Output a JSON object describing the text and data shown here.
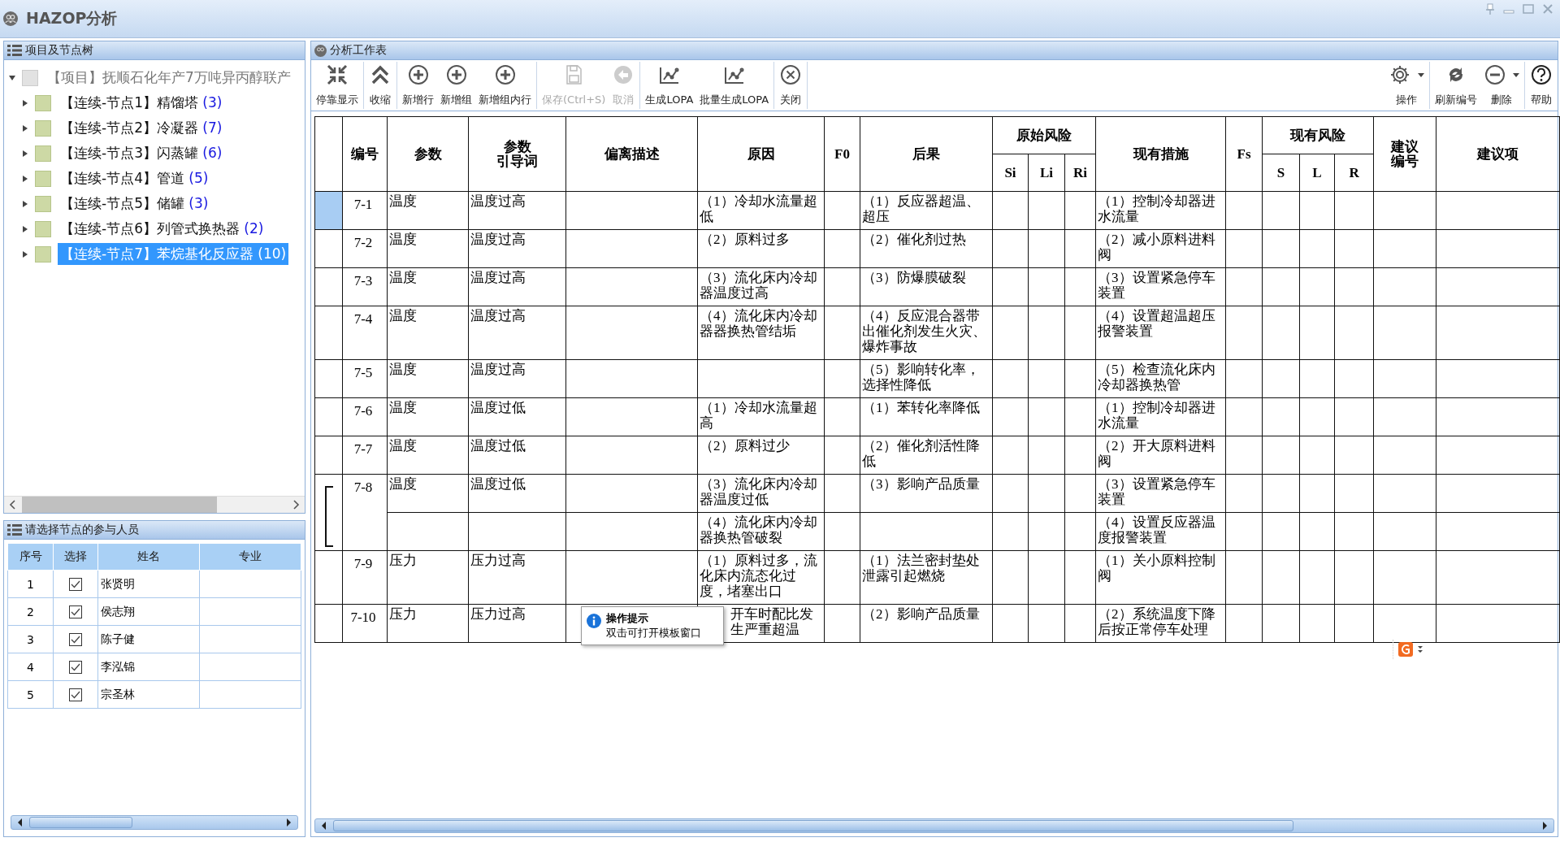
{
  "window": {
    "title": "HAZOP分析"
  },
  "tree_panel": {
    "title": "项目及节点树",
    "root": {
      "label": "【项目】抚顺石化年产7万吨异丙醇联产",
      "expanded": true,
      "children": [
        {
          "label": "【连续-节点1】精馏塔",
          "count": "(3)",
          "expanded": false,
          "selected": false
        },
        {
          "label": "【连续-节点2】冷凝器",
          "count": "(7)",
          "expanded": false,
          "selected": false
        },
        {
          "label": "【连续-节点3】闪蒸罐",
          "count": "(6)",
          "expanded": false,
          "selected": false
        },
        {
          "label": "【连续-节点4】管道",
          "count": "(5)",
          "expanded": false,
          "selected": false
        },
        {
          "label": "【连续-节点5】储罐",
          "count": "(3)",
          "expanded": false,
          "selected": false
        },
        {
          "label": "【连续-节点6】列管式换热器",
          "count": "(2)",
          "expanded": false,
          "selected": false
        },
        {
          "label": "【连续-节点7】苯烷基化反应器",
          "count": "(10)",
          "expanded": false,
          "selected": true
        }
      ]
    }
  },
  "people_panel": {
    "title": "请选择节点的参与人员",
    "columns": [
      "序号",
      "选择",
      "姓名",
      "专业"
    ],
    "rows": [
      {
        "no": "1",
        "checked": true,
        "name": "张贤明"
      },
      {
        "no": "2",
        "checked": true,
        "name": "侯志翔"
      },
      {
        "no": "3",
        "checked": true,
        "name": "陈子健"
      },
      {
        "no": "4",
        "checked": true,
        "name": "李泓锦"
      },
      {
        "no": "5",
        "checked": true,
        "name": "宗圣林"
      }
    ]
  },
  "worksheet": {
    "title": "分析工作表",
    "toolbar_left": [
      [
        {
          "label": "停靠显示",
          "kind": "dock",
          "disabled": false
        }
      ],
      [
        {
          "label": "收缩",
          "kind": "collapse",
          "disabled": false
        }
      ],
      [
        {
          "label": "新增行",
          "kind": "add",
          "disabled": false
        },
        {
          "label": "新增组",
          "kind": "add",
          "disabled": false
        },
        {
          "label": "新增组内行",
          "kind": "add",
          "disabled": false
        }
      ],
      [
        {
          "label": "保存(Ctrl+S)",
          "kind": "save",
          "disabled": true
        },
        {
          "label": "取消",
          "kind": "undo",
          "disabled": true
        }
      ],
      [
        {
          "label": "生成LOPA",
          "kind": "chart",
          "disabled": false
        },
        {
          "label": "批量生成LOPA",
          "kind": "chart",
          "disabled": false
        }
      ],
      [
        {
          "label": "关闭",
          "kind": "close",
          "disabled": false
        }
      ]
    ],
    "toolbar_right": [
      [
        {
          "label": "操作",
          "kind": "gear",
          "dropdown": true
        }
      ],
      [
        {
          "label": "刷新编号",
          "kind": "refresh",
          "dropdown": false
        },
        {
          "label": "删除",
          "kind": "remove",
          "dropdown": true
        }
      ],
      [
        {
          "label": "帮助",
          "kind": "help",
          "dropdown": false
        }
      ]
    ],
    "columns": [
      {
        "lines": [
          "编号"
        ]
      },
      {
        "lines": [
          "参数"
        ]
      },
      {
        "lines": [
          "参数",
          "引导词"
        ]
      },
      {
        "lines": [
          "偏离描述"
        ]
      },
      {
        "lines": [
          "原因"
        ]
      },
      {
        "lines": [
          "F0"
        ]
      },
      {
        "lines": [
          "后果"
        ]
      },
      {
        "lines": [
          "原始风险"
        ],
        "sub": [
          "Si",
          "Li",
          "Ri"
        ]
      },
      {
        "lines": [
          "现有措施"
        ]
      },
      {
        "lines": [
          "Fs"
        ]
      },
      {
        "lines": [
          "现有风险"
        ],
        "sub": [
          "S",
          "L",
          "R"
        ]
      },
      {
        "lines": [
          "建议",
          "编号"
        ]
      },
      {
        "lines": [
          "建议项"
        ]
      }
    ],
    "rows": [
      {
        "id": "7-1",
        "selected": true,
        "entries": [
          {
            "param": "温度",
            "guide": "温度过高",
            "cause": "（1）冷却水流量超低",
            "consequence": "（1）反应器超温、超压",
            "measure": "（1）控制冷却器进水流量"
          }
        ]
      },
      {
        "id": "7-2",
        "selected": false,
        "entries": [
          {
            "param": "温度",
            "guide": "温度过高",
            "cause": "（2）原料过多",
            "consequence": "（2）催化剂过热",
            "measure": "（2）减小原料进料阀"
          }
        ]
      },
      {
        "id": "7-3",
        "selected": false,
        "entries": [
          {
            "param": "温度",
            "guide": "温度过高",
            "cause": "（3）流化床内冷却器温度过高",
            "consequence": "（3）防爆膜破裂",
            "measure": "（3）设置紧急停车装置"
          }
        ]
      },
      {
        "id": "7-4",
        "selected": false,
        "entries": [
          {
            "param": "温度",
            "guide": "温度过高",
            "cause": "（4）流化床内冷却器器换热管结垢",
            "consequence": "（4）反应混合器带出催化剂发生火灾、爆炸事故",
            "measure": "（4）设置超温超压报警装置"
          }
        ]
      },
      {
        "id": "7-5",
        "selected": false,
        "entries": [
          {
            "param": "温度",
            "guide": "温度过高",
            "consequence": "（5）影响转化率，选择性降低",
            "measure": "（5）检查流化床内冷却器换热管"
          }
        ]
      },
      {
        "id": "7-6",
        "selected": false,
        "entries": [
          {
            "param": "温度",
            "guide": "温度过低",
            "cause": "（1）冷却水流量超高",
            "consequence": "（1）苯转化率降低",
            "measure": "（1）控制冷却器进水流量"
          }
        ]
      },
      {
        "id": "7-7",
        "selected": false,
        "entries": [
          {
            "param": "温度",
            "guide": "温度过低",
            "cause": "（2）原料过少",
            "consequence": "（2）催化剂活性降低",
            "measure": "（2）开大原料进料阀"
          }
        ]
      },
      {
        "id": "7-8",
        "selected": false,
        "entries": [
          {
            "param": "温度",
            "guide": "温度过低",
            "cause": "（3）流化床内冷却器温度过低",
            "consequence": "（3）影响产品质量",
            "measure": "（3）设置紧急停车装置"
          },
          {
            "cause": "（4）流化床内冷却器换热管破裂",
            "measure": "（4）设置反应器温度报警装置"
          }
        ]
      },
      {
        "id": "7-9",
        "selected": false,
        "entries": [
          {
            "param": "压力",
            "guide": "压力过高",
            "cause": "（1）原料过多，流化床内流态化过度，堵塞出口",
            "consequence": "（1）法兰密封垫处泄露引起燃烧",
            "measure": "（1）关小原料控制阀"
          }
        ]
      },
      {
        "id": "7-10",
        "selected": false,
        "entries": [
          {
            "param": "压力",
            "guide": "压力过高",
            "cause": "开车时配比发生严重超温",
            "consequence": "（2）影响产品质量",
            "measure": "（2）系统温度下降后按正常停车处理"
          }
        ]
      }
    ],
    "tooltip": {
      "title": "操作提示",
      "text": "双击可打开模板窗口"
    }
  }
}
